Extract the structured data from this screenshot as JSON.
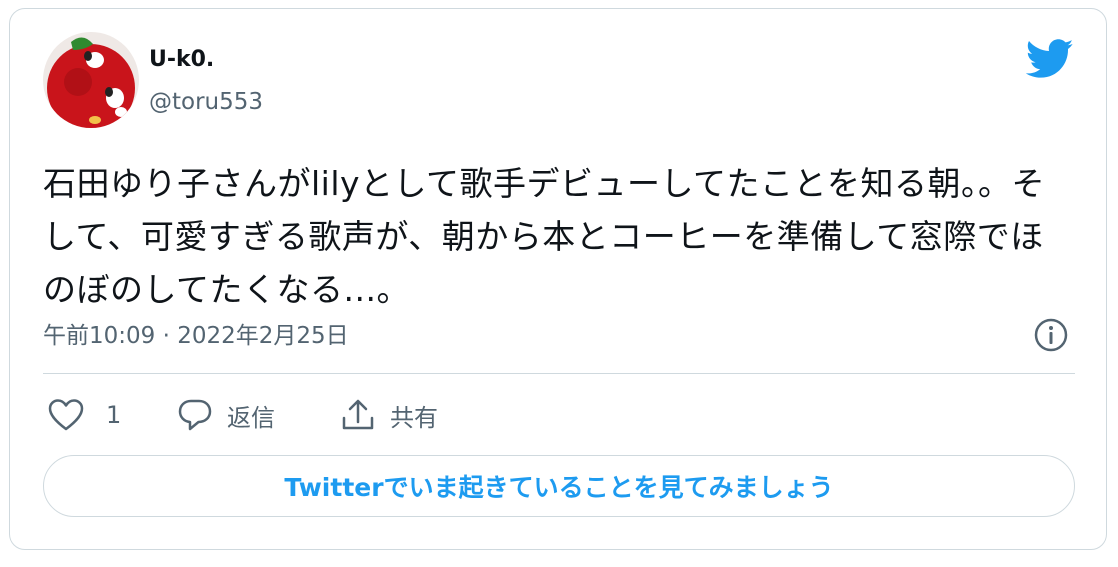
{
  "tweet": {
    "display_name": "U-k0.",
    "handle": "@toru553",
    "text": "石田ゆり子さんがlilyとして歌手デビューしてたことを知る朝。。そして、可愛すぎる歌声が、朝から本とコーヒーを準備して窓際でほのぼのしてたくなる...。",
    "timestamp": "午前10:09 · 2022年2月25日"
  },
  "actions": {
    "like_count": "1",
    "reply_label": "返信",
    "share_label": "共有"
  },
  "cta": {
    "label": "Twitterでいま起きていることを見てみましょう"
  },
  "icons": {
    "brand": "twitter-bird-icon",
    "info": "info-icon",
    "like": "heart-icon",
    "reply": "speech-bubble-icon",
    "share": "share-upload-icon"
  },
  "colors": {
    "brand_blue": "#1d9bf0",
    "text_primary": "#0f1419",
    "text_secondary": "#536471",
    "border": "#cfd9de"
  }
}
